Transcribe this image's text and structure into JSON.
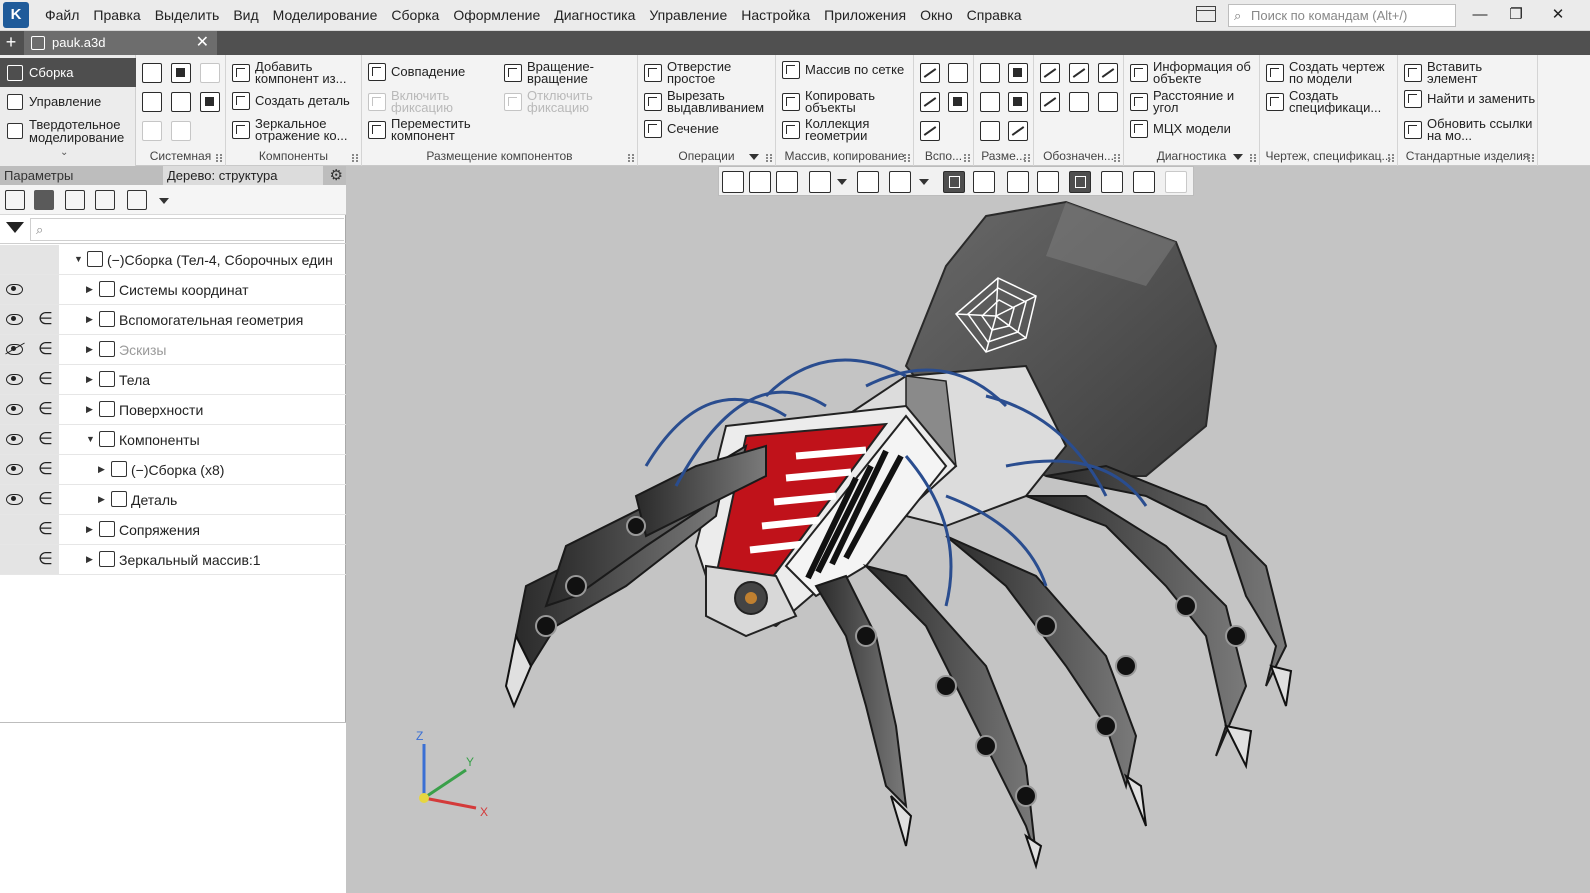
{
  "app": {
    "menu": [
      "Файл",
      "Правка",
      "Выделить",
      "Вид",
      "Моделирование",
      "Сборка",
      "Оформление",
      "Диагностика",
      "Управление",
      "Настройка",
      "Приложения",
      "Окно",
      "Справка"
    ],
    "search_placeholder": "Поиск по командам (Alt+/)",
    "window_controls": [
      "—",
      "❐",
      "✕"
    ]
  },
  "tabs": {
    "document": "pauk.a3d",
    "add": "+"
  },
  "ribbon": {
    "modes": [
      {
        "label": "Сборка",
        "icon": "assembly-icon",
        "active": true
      },
      {
        "label": "Управление",
        "icon": "management-icon",
        "active": false
      },
      {
        "label": "Твердотельное моделирование",
        "icon": "solid-modeling-icon",
        "active": false
      }
    ],
    "groups": {
      "system": {
        "label": "Системная"
      },
      "components": {
        "label": "Компоненты",
        "buttons": [
          "Добавить компонент из...",
          "Создать деталь",
          "Зеркальное отражение ко..."
        ]
      },
      "placement": {
        "label": "Размещение компонентов",
        "buttons": [
          "Совпадение",
          "Включить фиксацию",
          "Переместить компонент",
          "Вращение-вращение",
          "Отключить фиксацию"
        ]
      },
      "operations": {
        "label": "Операции",
        "buttons": [
          "Отверстие простое",
          "Вырезать выдавливанием",
          "Сечение"
        ]
      },
      "arrays": {
        "label": "Массив, копирование",
        "buttons": [
          "Массив по сетке",
          "Копировать объекты",
          "Коллекция геометрии"
        ]
      },
      "aux": {
        "label": "Вспо..."
      },
      "dims": {
        "label": "Разме..."
      },
      "annotations": {
        "label": "Обозначен..."
      },
      "diagnostics": {
        "label": "Диагностика",
        "buttons": [
          "Информация об объекте",
          "Расстояние и угол",
          "МЦХ модели"
        ]
      },
      "drawing": {
        "label": "Чертеж, спецификац...",
        "buttons": [
          "Создать чертеж по модели",
          "Создать спецификаци..."
        ]
      },
      "standard": {
        "label": "Стандартные изделия",
        "buttons": [
          "Вставить элемент",
          "Найти и заменить",
          "Обновить ссылки на мо..."
        ]
      }
    }
  },
  "left_panel": {
    "tabs": [
      "Параметры",
      "Дерево: структура"
    ],
    "filter_placeholder": "",
    "tree": [
      {
        "label": "(−)Сборка (Тел-4, Сборочных един",
        "level": 0,
        "expanded": true,
        "eye": "none",
        "incl": false,
        "dim": false
      },
      {
        "label": "Системы координат",
        "level": 1,
        "expanded": false,
        "eye": "visible",
        "incl": false,
        "dim": false
      },
      {
        "label": "Вспомогательная геометрия",
        "level": 1,
        "expanded": false,
        "eye": "visible",
        "incl": true,
        "dim": false
      },
      {
        "label": "Эскизы",
        "level": 1,
        "expanded": false,
        "eye": "hidden",
        "incl": true,
        "dim": true
      },
      {
        "label": "Тела",
        "level": 1,
        "expanded": false,
        "eye": "visible",
        "incl": true,
        "dim": false
      },
      {
        "label": "Поверхности",
        "level": 1,
        "expanded": false,
        "eye": "visible",
        "incl": true,
        "dim": false
      },
      {
        "label": "Компоненты",
        "level": 1,
        "expanded": true,
        "eye": "visible",
        "incl": true,
        "dim": false
      },
      {
        "label": "(−)Сборка (х8)",
        "level": 2,
        "expanded": false,
        "eye": "visible",
        "incl": true,
        "dim": false
      },
      {
        "label": "Деталь",
        "level": 2,
        "expanded": false,
        "eye": "visible",
        "incl": true,
        "dim": false
      },
      {
        "label": "Сопряжения",
        "level": 1,
        "expanded": false,
        "eye": "none",
        "incl": true,
        "dim": false
      },
      {
        "label": "Зеркальный массив:1",
        "level": 1,
        "expanded": false,
        "eye": "none",
        "incl": true,
        "dim": false
      }
    ]
  },
  "viewport": {
    "axes": {
      "x": "X",
      "y": "Y",
      "z": "Z"
    },
    "colors": {
      "background": "#c4c4c4",
      "body": "#5a5a5a",
      "accent_red": "#c0121a",
      "wires": "#2a4d8f",
      "axis_x": "#d43a3a",
      "axis_y": "#3aa04a",
      "axis_z": "#3a6fd4"
    }
  }
}
